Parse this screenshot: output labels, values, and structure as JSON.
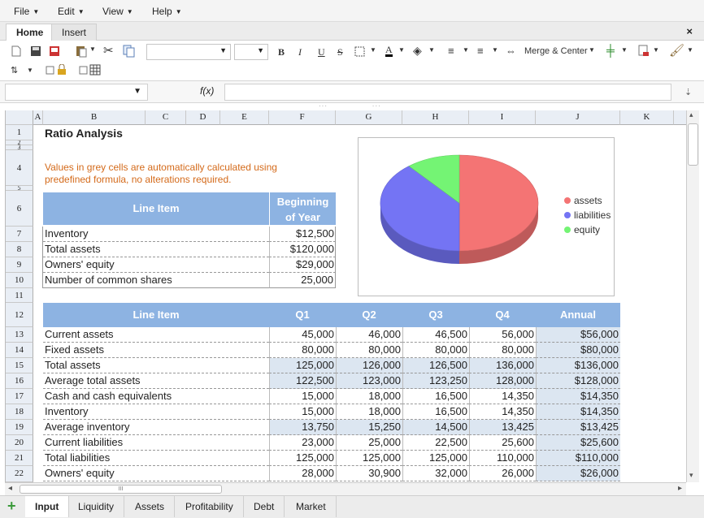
{
  "menu": {
    "file": "File",
    "edit": "Edit",
    "view": "View",
    "help": "Help"
  },
  "ribbon": {
    "home": "Home",
    "insert": "Insert",
    "close": "×",
    "merge": "Merge & Center",
    "bold": "B",
    "italic": "I",
    "underline": "U",
    "strike": "S",
    "font_color": "A"
  },
  "formula_bar": {
    "fx": "f(x)",
    "value": ""
  },
  "columns": [
    "A",
    "B",
    "C",
    "D",
    "E",
    "F",
    "G",
    "H",
    "I",
    "J",
    "K"
  ],
  "rows": [
    "1",
    "2",
    "3",
    "4",
    "5",
    "6",
    "7",
    "8",
    "9",
    "10",
    "11",
    "12",
    "13",
    "14",
    "15",
    "16",
    "17",
    "18",
    "19",
    "20",
    "21",
    "22"
  ],
  "sheet": {
    "title": "Ratio Analysis",
    "note_line1": "Values in grey cells are automatically calculated using",
    "note_line2": "predefined formula, no alterations required.",
    "t1": {
      "h_item": "Line Item",
      "h_boy1": "Beginning",
      "h_boy2": "of Year",
      "rows": [
        [
          "Inventory",
          "$12,500"
        ],
        [
          "Total assets",
          "$120,000"
        ],
        [
          "Owners' equity",
          "$29,000"
        ],
        [
          "Number of common shares",
          "25,000"
        ]
      ]
    },
    "t2": {
      "h": [
        "Line Item",
        "Q1",
        "Q2",
        "Q3",
        "Q4",
        "Annual"
      ],
      "rows": [
        [
          "Current assets",
          "45,000",
          "46,000",
          "46,500",
          "56,000",
          "$56,000"
        ],
        [
          "Fixed assets",
          "80,000",
          "80,000",
          "80,000",
          "80,000",
          "$80,000"
        ],
        [
          "Total assets",
          "125,000",
          "126,000",
          "126,500",
          "136,000",
          "$136,000"
        ],
        [
          "Average total assets",
          "122,500",
          "123,000",
          "123,250",
          "128,000",
          "$128,000"
        ],
        [
          "Cash and cash equivalents",
          "15,000",
          "18,000",
          "16,500",
          "14,350",
          "$14,350"
        ],
        [
          "Inventory",
          "15,000",
          "18,000",
          "16,500",
          "14,350",
          "$14,350"
        ],
        [
          "Average inventory",
          "13,750",
          "15,250",
          "14,500",
          "13,425",
          "$13,425"
        ],
        [
          "Current liabilities",
          "23,000",
          "25,000",
          "22,500",
          "25,600",
          "$25,600"
        ],
        [
          "Total liabilities",
          "125,000",
          "125,000",
          "125,000",
          "110,000",
          "$110,000"
        ],
        [
          "Owners' equity",
          "28,000",
          "30,900",
          "32,000",
          "26,000",
          "$26,000"
        ]
      ]
    }
  },
  "chart_data": {
    "type": "pie",
    "categories": [
      "assets",
      "liabilities",
      "equity"
    ],
    "values": [
      50,
      39,
      11
    ],
    "colors": [
      "#f47474",
      "#7474f4",
      "#74f474"
    ],
    "legend": "right"
  },
  "sheet_tabs": [
    "Input",
    "Liquidity",
    "Assets",
    "Profitability",
    "Debt",
    "Market"
  ],
  "scroll": {
    "left": "◂",
    "right": "▸",
    "up": "▴",
    "down": "▾",
    "grip": "III"
  }
}
